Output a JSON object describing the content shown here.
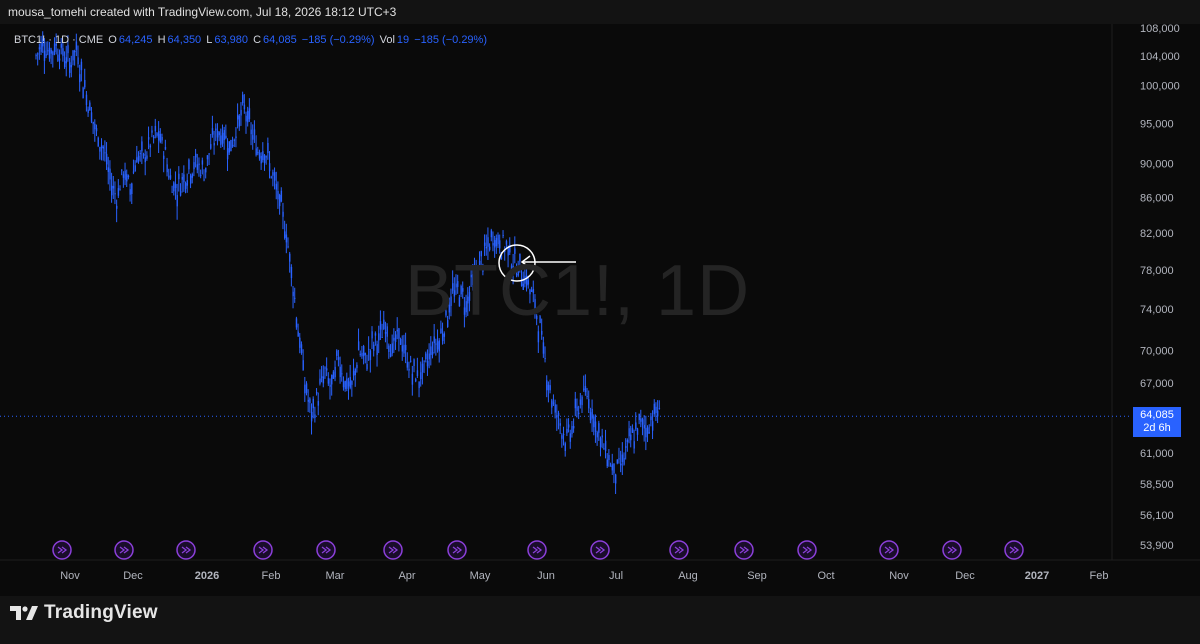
{
  "header": {
    "credit": "mousa_tomehi created with TradingView.com, Jul 18, 2026 18:12 UTC+3"
  },
  "legend": {
    "symbol": "BTC1! · 1D · CME",
    "open_label": "O",
    "open": "64,245",
    "high_label": "H",
    "high": "64,350",
    "low_label": "L",
    "low": "63,980",
    "close_label": "C",
    "close": "64,085",
    "change": "−185 (−0.29%)",
    "vol_label": "Vol",
    "vol": "19",
    "vol_change": "−185 (−0.29%)"
  },
  "watermark": "BTC1!, 1D",
  "price_tag": {
    "price": "64,085",
    "countdown": "2d 6h"
  },
  "footer": {
    "brand": "TradingView"
  },
  "colors": {
    "candle": "#2962ff",
    "background": "#0a0a0a",
    "event_icon": "#8b3fd9",
    "accent": "#2962ff"
  },
  "chart_data": {
    "type": "candlestick",
    "x_axis_labels": [
      "Nov",
      "Dec",
      "2026",
      "Feb",
      "Mar",
      "Apr",
      "May",
      "Jun",
      "Jul",
      "Aug",
      "Sep",
      "Oct",
      "Nov",
      "Dec",
      "2027",
      "Feb"
    ],
    "y_axis_labels": [
      "108,000",
      "104,000",
      "100,000",
      "95,000",
      "90,000",
      "86,000",
      "82,000",
      "78,000",
      "74,000",
      "70,000",
      "67,000",
      "64,085",
      "61,000",
      "58,500",
      "56,100",
      "53,900"
    ],
    "y_ticks": [
      108000,
      104000,
      100000,
      95000,
      90000,
      86000,
      82000,
      78000,
      74000,
      70000,
      67000,
      61000,
      58500,
      56100,
      53900
    ],
    "y_scale": "log",
    "last_price": 64085,
    "series": [
      {
        "date": "Nov",
        "close_path": [
          [
            0,
            104000
          ],
          [
            4,
            106000
          ],
          [
            8,
            104500
          ],
          [
            12,
            105500
          ],
          [
            16,
            104200
          ],
          [
            20,
            103000
          ],
          [
            24,
            105000
          ],
          [
            28,
            100500
          ],
          [
            32,
            97000
          ],
          [
            36,
            93500
          ],
          [
            40,
            92000
          ],
          [
            44,
            88000
          ],
          [
            48,
            86000
          ],
          [
            52,
            89000
          ],
          [
            56,
            87000
          ]
        ]
      },
      {
        "date": "Dec",
        "close_path": [
          [
            60,
            91000
          ],
          [
            64,
            90500
          ],
          [
            68,
            92500
          ],
          [
            72,
            93500
          ],
          [
            76,
            92000
          ],
          [
            80,
            88000
          ],
          [
            84,
            87000
          ],
          [
            88,
            88500
          ],
          [
            92,
            89500
          ],
          [
            96,
            90000
          ],
          [
            100,
            89000
          ]
        ]
      },
      {
        "date": "2026",
        "close_path": [
          [
            104,
            92000
          ],
          [
            108,
            94000
          ],
          [
            112,
            93500
          ],
          [
            116,
            92000
          ],
          [
            120,
            95000
          ],
          [
            124,
            97000
          ],
          [
            128,
            94000
          ],
          [
            132,
            91500
          ],
          [
            136,
            92000
          ],
          [
            140,
            89000
          ],
          [
            144,
            86000
          ],
          [
            148,
            83000
          ]
        ]
      },
      {
        "date": "Feb",
        "close_path": [
          [
            152,
            78000
          ],
          [
            156,
            72000
          ],
          [
            160,
            67000
          ],
          [
            164,
            64000
          ],
          [
            168,
            66000
          ],
          [
            172,
            68000
          ],
          [
            176,
            66500
          ],
          [
            180,
            69500
          ],
          [
            184,
            67000
          ],
          [
            188,
            66500
          ],
          [
            192,
            70000
          ]
        ]
      },
      {
        "date": "Mar",
        "close_path": [
          [
            196,
            69000
          ],
          [
            200,
            70500
          ],
          [
            204,
            71000
          ],
          [
            208,
            72500
          ],
          [
            212,
            70000
          ],
          [
            216,
            71500
          ],
          [
            220,
            69500
          ],
          [
            224,
            68000
          ],
          [
            228,
            67500
          ],
          [
            232,
            68500
          ],
          [
            236,
            70500
          ]
        ]
      },
      {
        "date": "Apr",
        "close_path": [
          [
            240,
            71000
          ],
          [
            244,
            73000
          ],
          [
            248,
            75500
          ],
          [
            252,
            76000
          ],
          [
            256,
            74500
          ],
          [
            260,
            77000
          ],
          [
            264,
            78500
          ],
          [
            268,
            80000
          ],
          [
            272,
            81500
          ]
        ]
      },
      {
        "date": "May",
        "close_path": [
          [
            276,
            81000
          ],
          [
            280,
            80500
          ],
          [
            284,
            79000
          ],
          [
            288,
            78000
          ],
          [
            292,
            77000
          ],
          [
            296,
            75000
          ],
          [
            300,
            72000
          ],
          [
            304,
            68000
          ],
          [
            308,
            65000
          ],
          [
            312,
            63500
          ]
        ]
      },
      {
        "date": "Jun",
        "close_path": [
          [
            316,
            62000
          ],
          [
            320,
            63500
          ],
          [
            324,
            65500
          ],
          [
            328,
            66000
          ],
          [
            332,
            64000
          ],
          [
            336,
            62000
          ],
          [
            340,
            61000
          ],
          [
            344,
            59500
          ],
          [
            348,
            60000
          ]
        ]
      },
      {
        "date": "Jul",
        "close_path": [
          [
            352,
            61500
          ],
          [
            356,
            62500
          ],
          [
            360,
            63500
          ],
          [
            364,
            63000
          ],
          [
            368,
            64500
          ],
          [
            372,
            64085
          ]
        ]
      }
    ]
  },
  "event_icon_count": 16,
  "annotation": "circle with arrow"
}
